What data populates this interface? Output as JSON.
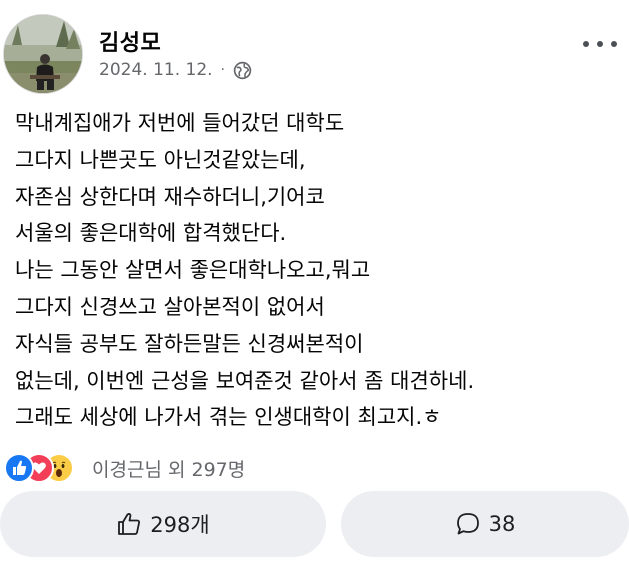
{
  "post": {
    "author": {
      "name": "김성모",
      "avatar": "profile-photo"
    },
    "timestamp": "2024. 11. 12.",
    "separator": "·",
    "privacy_icon": "globe-icon",
    "menu_icon": "more-options-icon",
    "body_lines": [
      "막내계집애가 저번에 들어갔던 대학도",
      "그다지 나쁜곳도 아닌것같았는데,",
      "자존심 상한다며 재수하더니,기어코",
      "서울의 좋은대학에 합격했단다.",
      "나는 그동안 살면서 좋은대학나오고,뭐고",
      "그다지 신경쓰고 살아본적이 없어서",
      "자식들 공부도 잘하든말든 신경써본적이",
      "없는데, 이번엔 근성을 보여준것 같아서 좀 대견하네.",
      "그래도 세상에 나가서 겪는 인생대학이 최고지.ㅎ"
    ],
    "reactions": {
      "icons": [
        "like-reaction-icon",
        "love-reaction-icon",
        "wow-reaction-icon"
      ],
      "summary": "이경근님 외 297명"
    },
    "actions": {
      "like_count": "298개",
      "comment_count": "38"
    }
  },
  "colors": {
    "text": "#050505",
    "secondary_text": "#65676b",
    "like_blue": "#1877f2",
    "love_red": "#f33e58",
    "wow_yellow": "#fbcd46",
    "button_bg": "#eceef1"
  }
}
